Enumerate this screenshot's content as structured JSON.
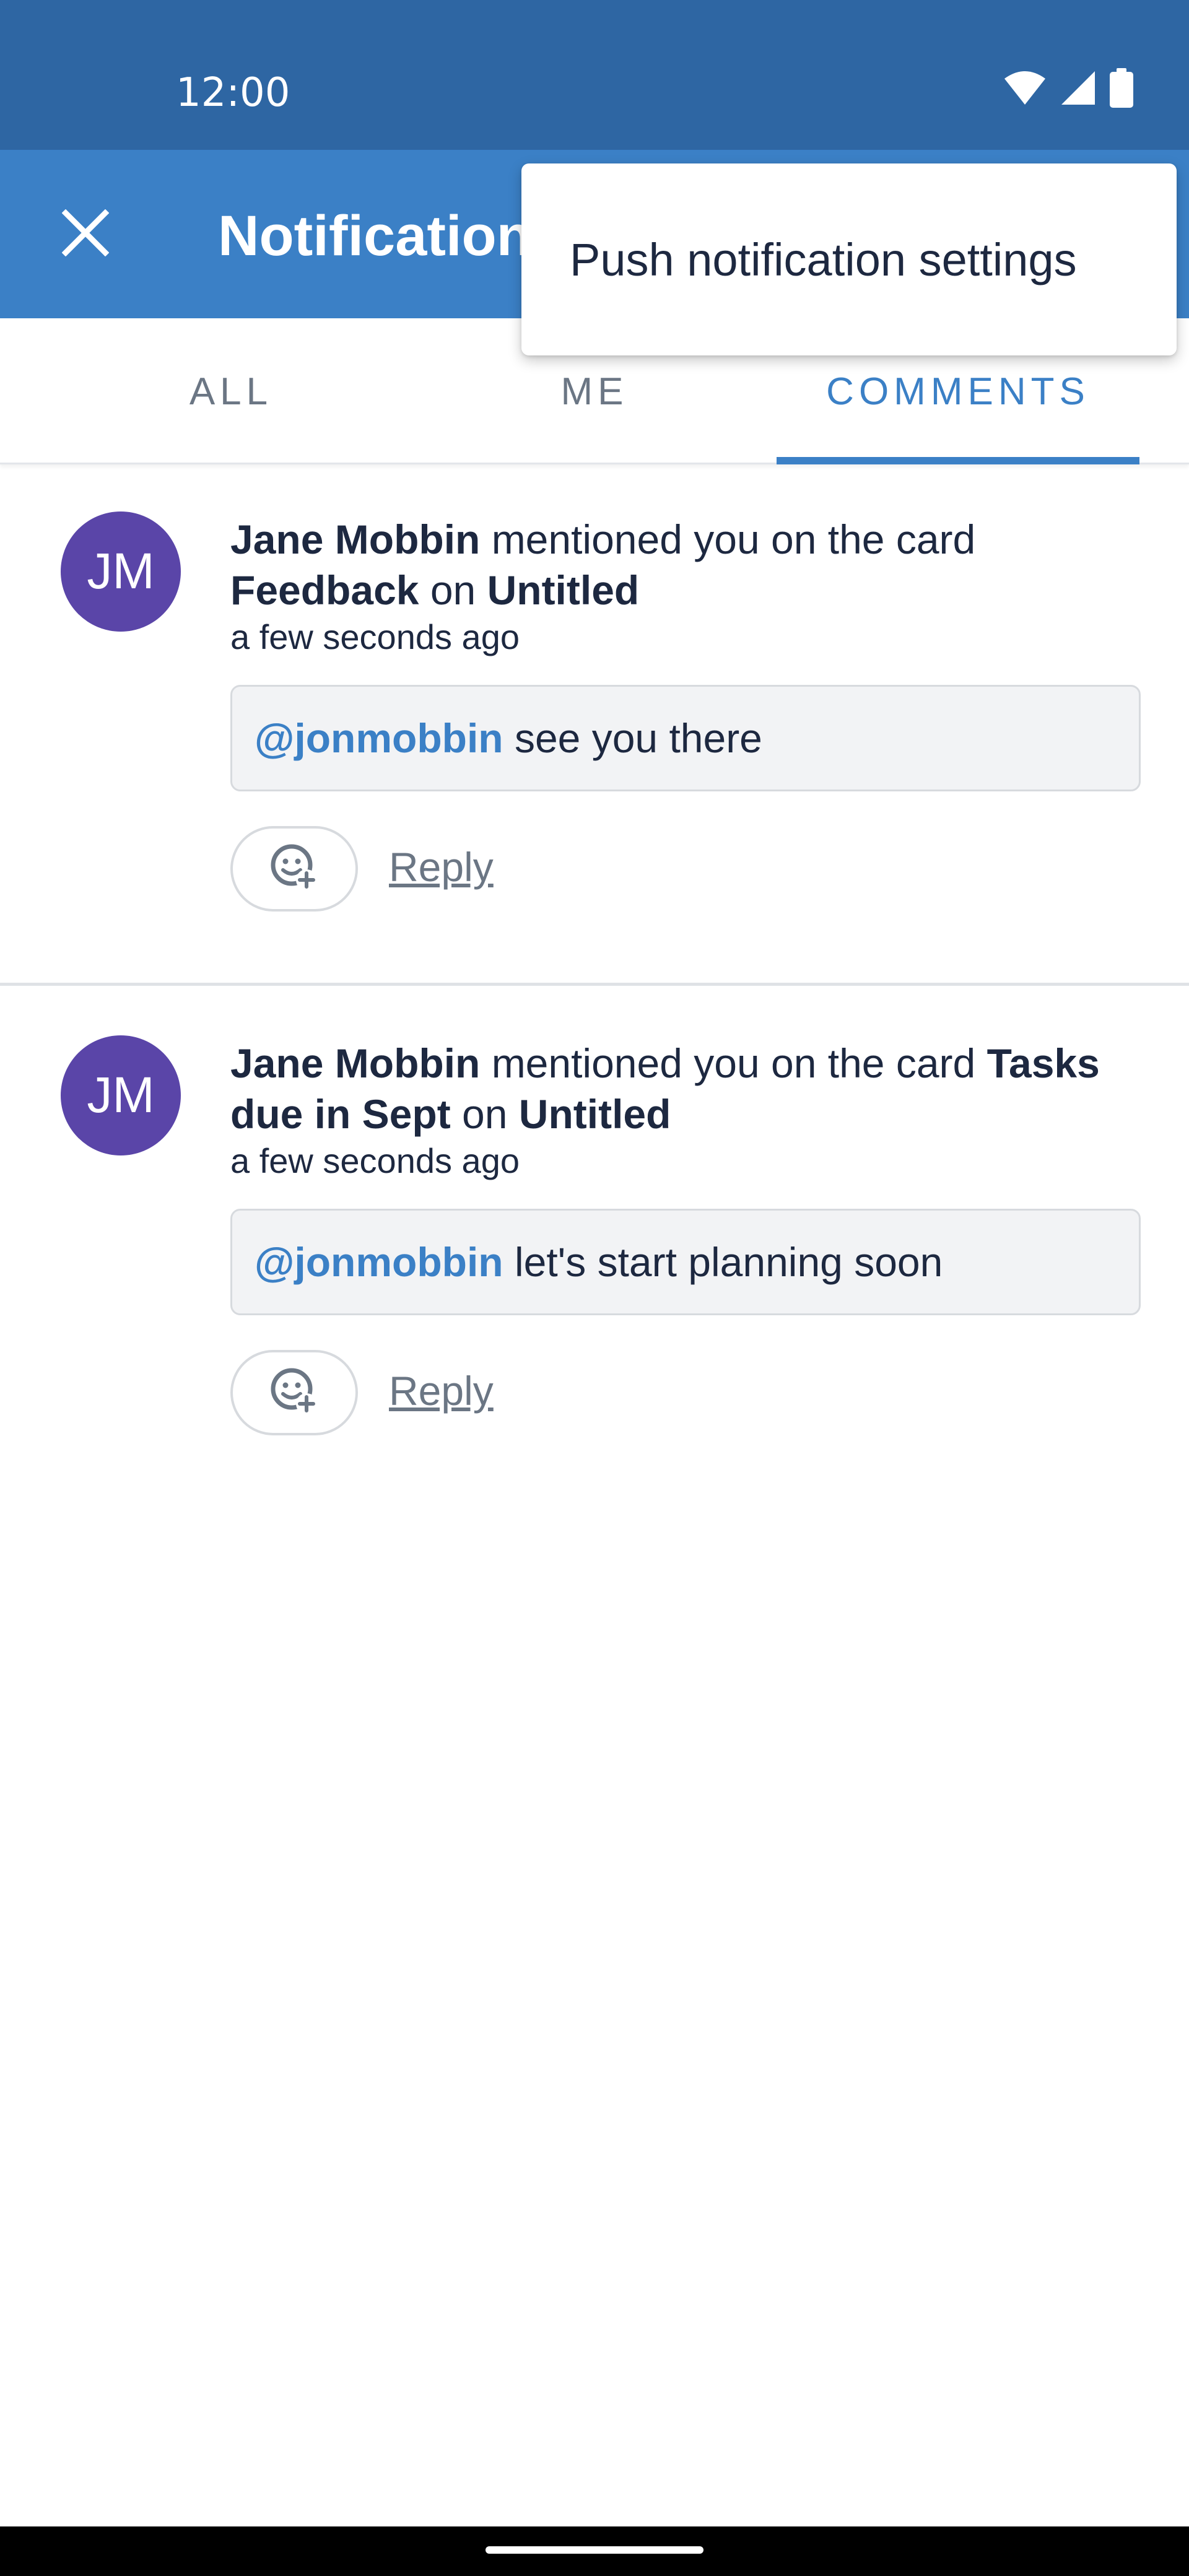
{
  "status_bar": {
    "time": "12:00"
  },
  "app_bar": {
    "title": "Notifications"
  },
  "tabs": [
    {
      "label": "ALL"
    },
    {
      "label": "ME"
    },
    {
      "label": "COMMENTS"
    }
  ],
  "menu": {
    "item": "Push notification settings"
  },
  "notifications": [
    {
      "avatar": "JM",
      "actor": "Jane Mobbin",
      "action": "mentioned you on the card",
      "card": "Feedback",
      "connector": "on",
      "board": "Untitled",
      "time": "a few seconds ago",
      "mention": "@jonmobbin",
      "comment": "see you there",
      "reply": "Reply"
    },
    {
      "avatar": "JM",
      "actor": "Jane Mobbin",
      "action": "mentioned you on the card",
      "card": "Tasks due in Sept",
      "connector": "on",
      "board": "Untitled",
      "time": "a few seconds ago",
      "mention": "@jonmobbin",
      "comment": "let's start planning soon",
      "reply": "Reply"
    }
  ],
  "colors": {
    "status_bar": "#2e66a3",
    "app_bar": "#3b80c6",
    "accent": "#3b80c6",
    "avatar": "#5a45a8"
  },
  "icons": {
    "close": "close-icon",
    "wifi": "wifi-icon",
    "signal": "signal-icon",
    "battery": "battery-icon",
    "reaction": "add-reaction-icon"
  }
}
